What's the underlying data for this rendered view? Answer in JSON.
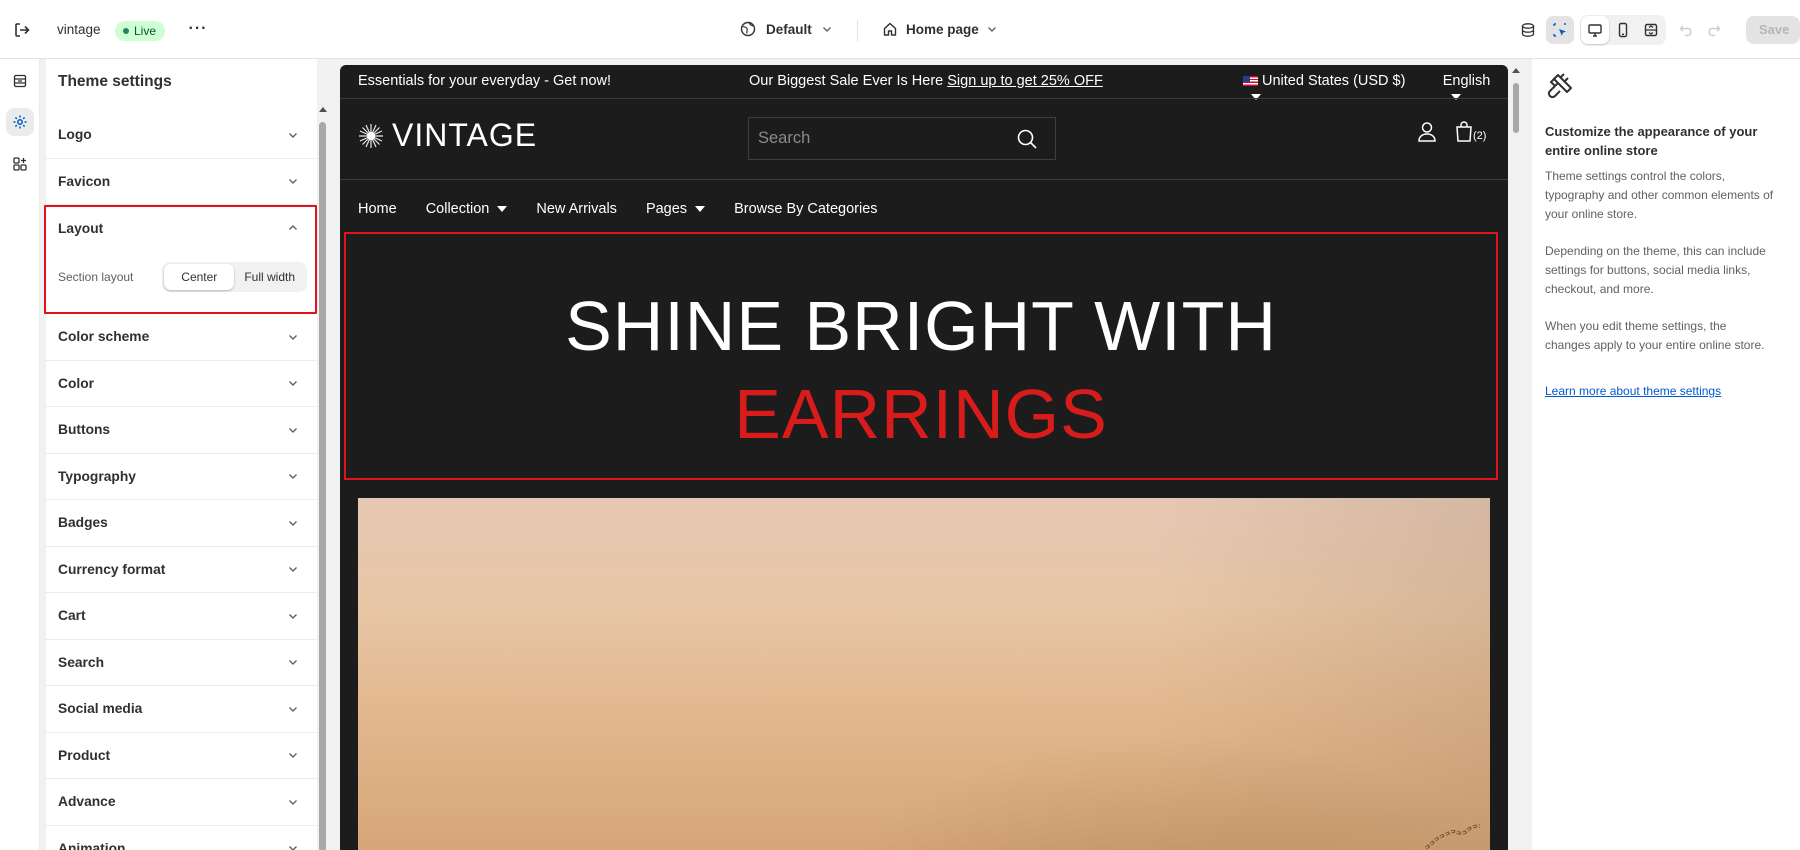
{
  "topbar": {
    "store_name": "vintage",
    "status_badge": "Live",
    "theme_name": "Default",
    "page_selector": "Home page",
    "save_label": "Save"
  },
  "settings": {
    "title": "Theme settings",
    "items": [
      {
        "label": "Logo"
      },
      {
        "label": "Favicon"
      },
      {
        "label": "Layout"
      },
      {
        "label": "Color scheme"
      },
      {
        "label": "Color"
      },
      {
        "label": "Buttons"
      },
      {
        "label": "Typography"
      },
      {
        "label": "Badges"
      },
      {
        "label": "Currency format"
      },
      {
        "label": "Cart"
      },
      {
        "label": "Search"
      },
      {
        "label": "Social media"
      },
      {
        "label": "Product"
      },
      {
        "label": "Advance"
      },
      {
        "label": "Animation"
      }
    ],
    "layout": {
      "field_label": "Section layout",
      "options": [
        "Center",
        "Full width"
      ],
      "selected": "Center"
    }
  },
  "preview": {
    "announcement_left": "Essentials for your everyday - Get now!",
    "announcement_mid": "Our Biggest Sale Ever Is Here",
    "announcement_link": "Sign up to get 25% OFF",
    "currency": "United States (USD $)",
    "language": "English",
    "logo_text": "VINTAGE",
    "search_placeholder": "Search",
    "cart_count": "(2)",
    "nav": [
      "Home",
      "Collection",
      "New Arrivals",
      "Pages",
      "Browse By Categories"
    ],
    "hero_line1": "SHINE BRIGHT WITH",
    "hero_line2": "EARRINGS"
  },
  "info": {
    "heading": "Customize the appearance of your entire online store",
    "p1": "Theme settings control the colors, typography and other common elements of your online store.",
    "p2": "Depending on the theme, this can include settings for buttons, social media links, checkout, and more.",
    "p3": "When you edit theme settings, the changes apply to your entire online store.",
    "link": "Learn more about theme settings"
  },
  "colors": {
    "highlight_red": "#e0121a",
    "live_badge_bg": "#cdfed4",
    "preview_bg": "#1c1c1c",
    "hero_accent": "#d81b1b",
    "link_blue": "#005bd3"
  }
}
